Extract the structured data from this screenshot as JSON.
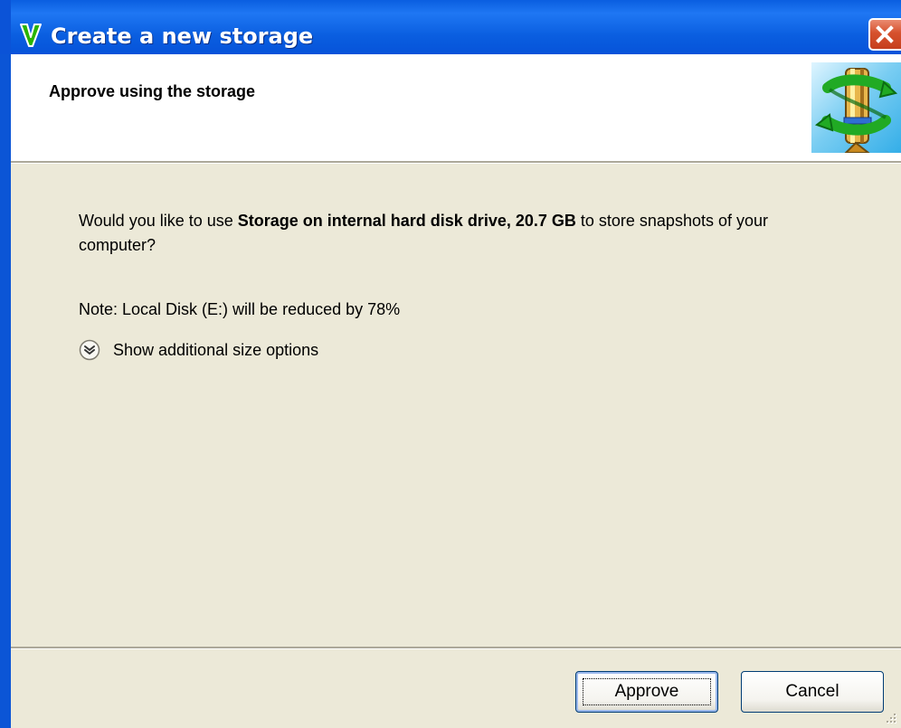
{
  "window": {
    "title": "Create a new storage",
    "app_icon": "green-check-icon",
    "close_icon": "close-icon"
  },
  "header": {
    "title": "Approve using the storage",
    "graphic": "storage-sync-icon"
  },
  "content": {
    "question_prefix": "Would you like to use ",
    "storage_name": "Storage on internal hard disk drive, 20.7 GB",
    "question_suffix": " to store snapshots of your computer?",
    "note": "Note: Local Disk (E:) will be reduced by 78%",
    "expand_label": "Show additional size options",
    "expand_icon": "chevron-double-down-icon"
  },
  "buttons": {
    "approve": "Approve",
    "cancel": "Cancel"
  },
  "colors": {
    "title_bar_blue": "#0a5ee0",
    "dialog_background": "#ece9d8",
    "close_red": "#d6512d",
    "accent_green": "#24a900"
  }
}
